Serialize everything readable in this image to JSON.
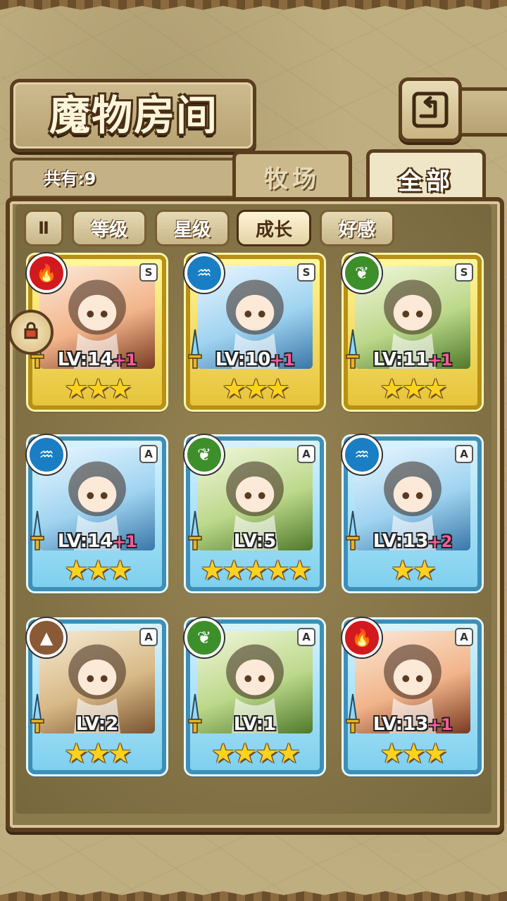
{
  "header": {
    "title": "魔物房间",
    "count_label": "共有:9"
  },
  "tabs": [
    {
      "label": "牧场",
      "active": false
    },
    {
      "label": "全部",
      "active": true
    }
  ],
  "filters": [
    {
      "label": "等级",
      "active": false
    },
    {
      "label": "星级",
      "active": false
    },
    {
      "label": "成长",
      "active": true
    },
    {
      "label": "好感",
      "active": false
    }
  ],
  "sort_icon": "Ⅱ",
  "cards": [
    {
      "rank": "S",
      "element": "fire",
      "element_icon": "🔥",
      "level": "LV:14",
      "bonus": "+1",
      "stars": "★★★",
      "frame": "gold"
    },
    {
      "rank": "S",
      "element": "water",
      "element_icon": "♒",
      "level": "LV:10",
      "bonus": "+1",
      "stars": "★★★",
      "frame": "gold"
    },
    {
      "rank": "S",
      "element": "grass",
      "element_icon": "❦",
      "level": "LV:11",
      "bonus": "+1",
      "stars": "★★★",
      "frame": "gold"
    },
    {
      "rank": "A",
      "element": "water",
      "element_icon": "♒",
      "level": "LV:14",
      "bonus": "+1",
      "stars": "★★★",
      "frame": "blue"
    },
    {
      "rank": "A",
      "element": "grass",
      "element_icon": "❦",
      "level": "LV:5",
      "bonus": "",
      "stars": "★★★★★",
      "frame": "blue"
    },
    {
      "rank": "A",
      "element": "water",
      "element_icon": "♒",
      "level": "LV:13",
      "bonus": "+2",
      "stars": "★★",
      "frame": "blue"
    },
    {
      "rank": "A",
      "element": "earth",
      "element_icon": "▲",
      "level": "LV:2",
      "bonus": "",
      "stars": "★★★",
      "frame": "blue"
    },
    {
      "rank": "A",
      "element": "grass",
      "element_icon": "❦",
      "level": "LV:1",
      "bonus": "",
      "stars": "★★★★",
      "frame": "blue"
    },
    {
      "rank": "A",
      "element": "fire",
      "element_icon": "🔥",
      "level": "LV:13",
      "bonus": "+1",
      "stars": "★★★",
      "frame": "blue"
    }
  ],
  "colors": {
    "gold_frame": "#e7c43a",
    "blue_frame": "#7ed0ef",
    "fire": "#d1191e",
    "water": "#1a7ec4",
    "grass": "#3d8f2a",
    "earth": "#8a5a36",
    "bonus": "#ff5a9c"
  }
}
